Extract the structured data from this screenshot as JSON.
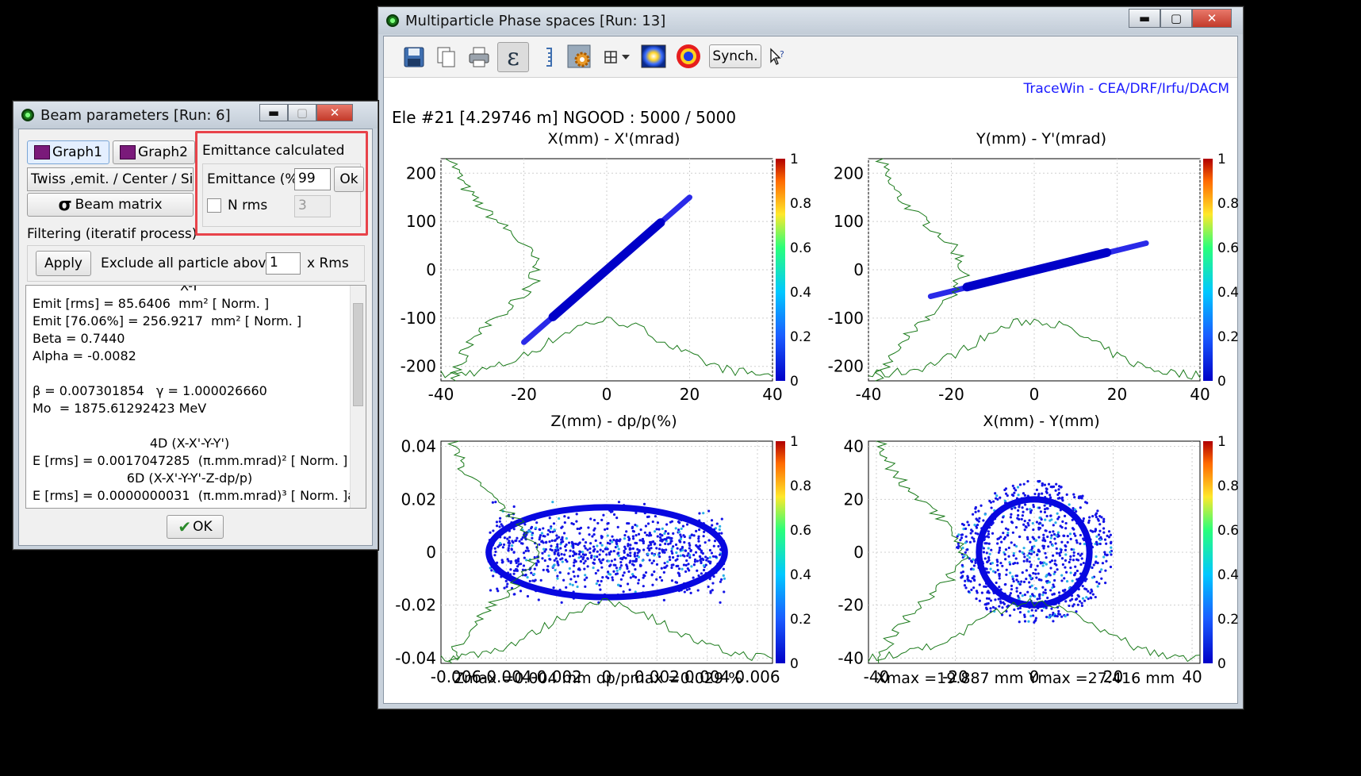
{
  "beam_window": {
    "title": "Beam parameters [Run: 6]",
    "tab_graph1": "Graph1",
    "tab_graph2": "Graph2",
    "twiss_tab": "Twiss ,emit. / Center / Size",
    "beam_matrix": "Beam matrix",
    "sigma_symbol": "σ",
    "filtering_label": "Filtering (iteratif process)",
    "apply_label": "Apply",
    "exclude_label": "Exclude all particle above",
    "exclude_value": "1",
    "exclude_unit": "x Rms",
    "emittance_group": "Emittance calculated",
    "emittance_label": "Emittance (%)",
    "emittance_value": "99",
    "ok_small": "Ok",
    "nrms_label": "N rms",
    "nrms_value": "3",
    "text_lines": [
      "X-Y",
      "Emit [rms] = 85.6406  mm² [ Norm. ]",
      "Emit [76.06%] = 256.9217  mm² [ Norm. ]",
      "Beta = 0.7440",
      "Alpha = -0.0082",
      "",
      "β = 0.007301854   γ = 1.000026660",
      "Mo  = 1875.61292423 MeV",
      "",
      "4D (X-X'-Y-Y')",
      "E [rms] = 0.0017047285  (π.mm.mrad)² [ Norm. ]",
      "6D (X-X'-Y-Y'-Z-dp/p)",
      "E [rms] = 0.0000000031  (π.mm.mrad)³ [ Norm. ]a"
    ],
    "ok_button": "OK",
    "check_glyph": "✔"
  },
  "phase_window": {
    "title": "Multiparticle Phase spaces [Run: 13]",
    "synch_label": "Synch.",
    "epsilon_glyph": "ε",
    "brand": "TraceWin - CEA/DRF/Irfu/DACM",
    "element_info": "Ele #21 [4.29746 m]",
    "ngood": "NGOOD : 5000 / 5000",
    "zmax_text": "Zmax =0.004 mm  dp/pmax =0.029 %",
    "xmax_text": "Xmax =19.887 mm  Ymax =27.416 mm"
  },
  "caption": {
    "minimize": "▬",
    "maximize": "▢",
    "close": "✕"
  },
  "colors": {
    "particles": "#1414e6",
    "profile": "#1a7a1a",
    "brand": "#1a1aff",
    "highlight": "#e8434a"
  },
  "chart_data": [
    {
      "type": "scatter",
      "title": "X(mm) - X'(mrad)",
      "xlim": [
        -40,
        40
      ],
      "ylim": [
        -230,
        230
      ],
      "xticks": [
        -40,
        -20,
        0,
        20,
        40
      ],
      "yticks": [
        -200,
        -100,
        0,
        100,
        200
      ],
      "xtick_labels": [
        "-40",
        "-20",
        "0",
        "20",
        "40"
      ],
      "ytick_labels": [
        "-200",
        "-100",
        "0",
        "100",
        "200"
      ],
      "colorbar_ticks": [
        "0",
        "0.2",
        "0.4",
        "0.6",
        "0.8",
        "1"
      ],
      "distribution": {
        "kind": "line",
        "from": [
          -20,
          -150
        ],
        "to": [
          20,
          150
        ]
      }
    },
    {
      "type": "scatter",
      "title": "Y(mm) - Y'(mrad)",
      "xlim": [
        -40,
        40
      ],
      "ylim": [
        -230,
        230
      ],
      "xticks": [
        -40,
        -20,
        0,
        20,
        40
      ],
      "yticks": [
        -200,
        -100,
        0,
        100,
        200
      ],
      "xtick_labels": [
        "-40",
        "-20",
        "0",
        "20",
        "40"
      ],
      "ytick_labels": [
        "-200",
        "-100",
        "0",
        "100",
        "200"
      ],
      "colorbar_ticks": [
        "0",
        "0.2",
        "0.4",
        "0.6",
        "0.8",
        "1"
      ],
      "distribution": {
        "kind": "line",
        "from": [
          -25,
          -55
        ],
        "to": [
          27,
          55
        ]
      }
    },
    {
      "type": "scatter",
      "title": "Z(mm) - dp/p(%)",
      "xlim": [
        -0.0066,
        0.0066
      ],
      "ylim": [
        -0.042,
        0.042
      ],
      "xticks": [
        -0.006,
        -0.004,
        -0.002,
        0,
        0.002,
        0.004,
        0.006
      ],
      "yticks": [
        -0.04,
        -0.02,
        0,
        0.02,
        0.04
      ],
      "xtick_labels": [
        "-0.006",
        "-0.004",
        "-0.002",
        "0",
        "0.002",
        "0.004",
        "0.006"
      ],
      "ytick_labels": [
        "-0.04",
        "-0.02",
        "0",
        "0.02",
        "0.04"
      ],
      "colorbar_ticks": [
        "0",
        "0.2",
        "0.4",
        "0.6",
        "0.8",
        "1"
      ],
      "distribution": {
        "kind": "box",
        "xrange": [
          -0.0047,
          0.0047
        ],
        "yrange": [
          -0.019,
          0.019
        ],
        "ellipse": [
          0,
          0,
          0.0047,
          0.017
        ]
      }
    },
    {
      "type": "scatter",
      "title": "X(mm) - Y(mm)",
      "xlim": [
        -42,
        42
      ],
      "ylim": [
        -42,
        42
      ],
      "xticks": [
        -40,
        -20,
        0,
        20,
        40
      ],
      "yticks": [
        -40,
        -20,
        0,
        20,
        40
      ],
      "xtick_labels": [
        "-40",
        "-20",
        "0",
        "20",
        "40"
      ],
      "ytick_labels": [
        "-40",
        "-20",
        "0",
        "20",
        "40"
      ],
      "colorbar_ticks": [
        "0",
        "0.2",
        "0.4",
        "0.6",
        "0.8",
        "1"
      ],
      "distribution": {
        "kind": "disk",
        "center": [
          0,
          0
        ],
        "radius": [
          20,
          27
        ],
        "ellipse": [
          0,
          0,
          14,
          20
        ]
      }
    }
  ]
}
